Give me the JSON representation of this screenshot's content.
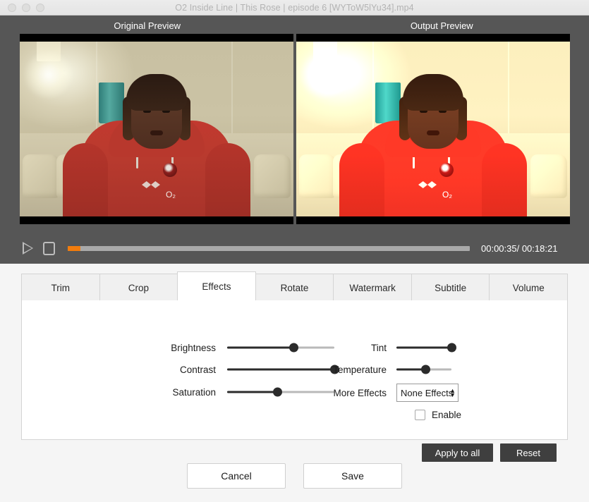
{
  "window": {
    "title": "O2 Inside Line  |  This Rose  |  episode 6 [WYToW5lYu34].mp4",
    "traffic_lights": [
      "close",
      "minimize",
      "zoom"
    ]
  },
  "preview": {
    "original_label": "Original Preview",
    "output_label": "Output  Preview"
  },
  "transport": {
    "play_icon": "play-icon",
    "stop_icon": "stop-icon",
    "current_time": "00:00:35",
    "total_time": "00:18:21",
    "timecode": "00:00:35/ 00:18:21",
    "progress_percent": 3.2,
    "progress_color": "#f27c0c"
  },
  "tabs": [
    {
      "label": "Trim",
      "active": false
    },
    {
      "label": "Crop",
      "active": false
    },
    {
      "label": "Effects",
      "active": true
    },
    {
      "label": "Rotate",
      "active": false
    },
    {
      "label": "Watermark",
      "active": false
    },
    {
      "label": "Subtitle",
      "active": false
    },
    {
      "label": "Volume",
      "active": false
    }
  ],
  "effects": {
    "sliders_left": [
      {
        "label": "Brightness",
        "value": 62
      },
      {
        "label": "Contrast",
        "value": 100
      },
      {
        "label": "Saturation",
        "value": 47
      }
    ],
    "sliders_right": [
      {
        "label": "Tint",
        "value": 100
      },
      {
        "label": "Temperature",
        "value": 53
      }
    ],
    "more_effects": {
      "label": "More Effects",
      "selected": "None Effects",
      "options": [
        "None Effects"
      ],
      "stepper_icon": "stepper-updown-icon"
    },
    "enable": {
      "label": "Enable",
      "checked": false
    },
    "apply_all_label": "Apply to all",
    "reset_label": "Reset"
  },
  "footer": {
    "cancel_label": "Cancel",
    "save_label": "Save"
  },
  "colors": {
    "chrome_dark": "#565656",
    "accent_orange": "#f27c0c",
    "panel_bg": "#f5f5f5",
    "button_dark": "#3f3f3f"
  }
}
